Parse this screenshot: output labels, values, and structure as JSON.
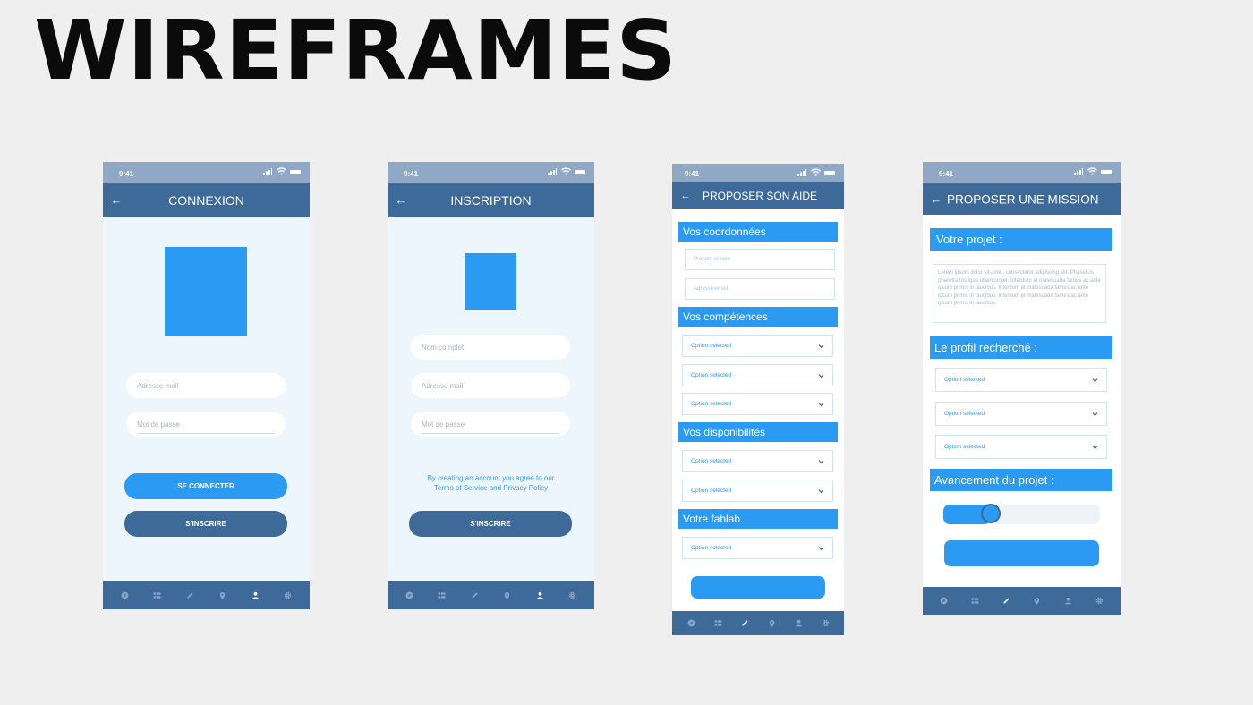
{
  "page_title": "WIREFRAMES",
  "status_time": "9:41",
  "colors": {
    "primary": "#2b9af3",
    "dark": "#3e6a9a",
    "statusbar": "#8ea8c6",
    "background": "#efefef"
  },
  "nav_icons": [
    "compass-icon",
    "grid-icon",
    "pencil-icon",
    "location-icon",
    "user-icon",
    "gear-icon"
  ],
  "screens": {
    "connexion": {
      "title": "CONNEXION",
      "email_placeholder": "Adresse mail",
      "password_placeholder": "Mot de passe",
      "connect_label": "SE CONNECTER",
      "signup_label": "S'INSCRIRE",
      "active_nav": "user-icon"
    },
    "inscription": {
      "title": "INSCRIPTION",
      "name_placeholder": "Nom complet",
      "email_placeholder": "Adresse mail",
      "password_placeholder": "Mot de passe",
      "terms_line1": "By creating an account you agree to our",
      "terms_line2": "Terms of Service and Privacy Policy",
      "signup_label": "S'INSCRIRE",
      "active_nav": "user-icon"
    },
    "aide": {
      "title": "PROPOSER SON AIDE",
      "section_coordonnees": "Vos coordonnées",
      "name_placeholder": "Prénom et nom",
      "email_placeholder": "Adresse email",
      "section_competences": "Vos compétences",
      "section_disponibilites": "Vos disponibilités",
      "section_fablab": "Votre fablab",
      "option_label": "Option selected",
      "active_nav": "pencil-icon"
    },
    "mission": {
      "title": "PROPOSER UNE MISSION",
      "section_projet": "Votre projet :",
      "lorem": "Lorem ipsum dolor sit amet, consectetur adipiscing elit. Phasellus pharetra tristique ullamcorper. Interdum et malesuada fames ac ante ipsum primis in faucibus. Interdum et malesuada fames ac ante ipsum primis in faucibus. Interdum et malesuada fames ac ante ipsum primis in faucibus.",
      "section_profil": "Le profil recherché :",
      "option_label": "Option selected",
      "section_avancement": "Avancement du projet :",
      "progress": 0.3,
      "active_nav": "pencil-icon"
    }
  }
}
